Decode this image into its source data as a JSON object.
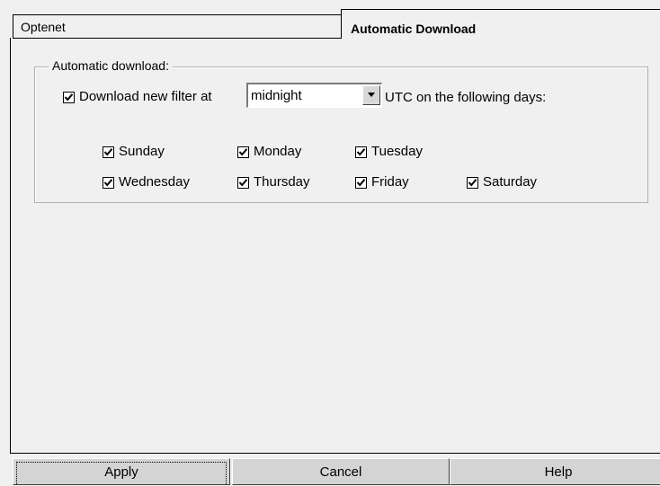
{
  "tabs": [
    {
      "label": "Optenet",
      "active": false
    },
    {
      "label": "Automatic Download",
      "active": true
    }
  ],
  "group": {
    "title": "Automatic download:",
    "download": {
      "checked": true,
      "label_before": "Download new filter at",
      "time_value": "midnight",
      "label_after": "UTC on the following days:"
    },
    "days": [
      {
        "label": "Sunday",
        "checked": true
      },
      {
        "label": "Monday",
        "checked": true
      },
      {
        "label": "Tuesday",
        "checked": true
      },
      {
        "label": "Wednesday",
        "checked": true
      },
      {
        "label": "Thursday",
        "checked": true
      },
      {
        "label": "Friday",
        "checked": true
      },
      {
        "label": "Saturday",
        "checked": true
      }
    ]
  },
  "buttons": {
    "apply": "Apply",
    "cancel": "Cancel",
    "help": "Help"
  }
}
